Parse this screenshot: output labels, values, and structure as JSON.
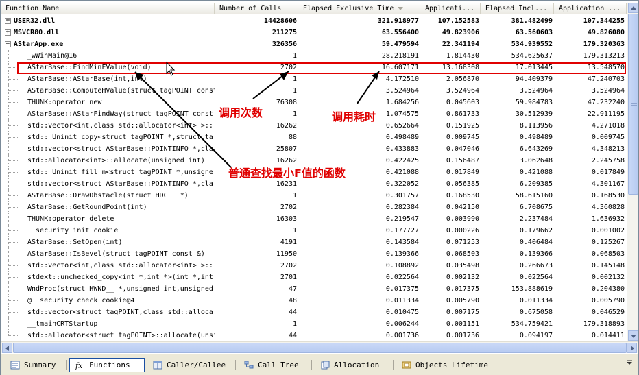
{
  "columns": [
    "Function Name",
    "Number of Calls",
    "Elapsed Exclusive Time",
    "Applicati...",
    "Elapsed Incl...",
    "Application ..."
  ],
  "rows": [
    {
      "name": "USER32.dll",
      "expander": "+",
      "bold": true,
      "level": 0,
      "v": [
        "14428606",
        "321.918977",
        "107.152583",
        "381.482499",
        "107.344255"
      ]
    },
    {
      "name": "MSVCR80.dll",
      "expander": "+",
      "bold": true,
      "level": 0,
      "v": [
        "211275",
        "63.556400",
        "49.823906",
        "63.560603",
        "49.826080"
      ]
    },
    {
      "name": "AStarApp.exe",
      "expander": "−",
      "bold": true,
      "level": 0,
      "v": [
        "326356",
        "59.479594",
        "22.341194",
        "534.939552",
        "179.320363"
      ]
    },
    {
      "name": "_wWinMain@16",
      "level": 1,
      "v": [
        "1",
        "28.218191",
        "1.814430",
        "534.625637",
        "179.313213"
      ]
    },
    {
      "name": "AStarBase::FindMinFValue(void)",
      "level": 1,
      "v": [
        "2702",
        "16.607171",
        "13.168308",
        "17.013445",
        "13.548570"
      ]
    },
    {
      "name": "AStarBase::AStarBase(int,int)",
      "level": 1,
      "v": [
        "1",
        "4.172510",
        "2.056870",
        "94.409379",
        "47.240703"
      ]
    },
    {
      "name": "AStarBase::ComputeHValue(struct tagPOINT const",
      "level": 1,
      "v": [
        "1",
        "3.524964",
        "3.524964",
        "3.524964",
        "3.524964"
      ]
    },
    {
      "name": "THUNK:operator new",
      "level": 1,
      "v": [
        "76308",
        "1.684256",
        "0.045603",
        "59.984783",
        "47.232240"
      ]
    },
    {
      "name": "AStarBase::AStarFindWay(struct tagPOINT const",
      "level": 1,
      "v": [
        "1",
        "1.074575",
        "0.861733",
        "30.512939",
        "22.911195"
      ]
    },
    {
      "name": "std::vector<int,class std::allocator<int> >::",
      "level": 1,
      "v": [
        "16262",
        "0.652664",
        "0.151925",
        "8.113956",
        "4.271018"
      ]
    },
    {
      "name": "std::_Uninit_copy<struct tagPOINT *,struct ta",
      "level": 1,
      "v": [
        "88",
        "0.498489",
        "0.009745",
        "0.498489",
        "0.009745"
      ]
    },
    {
      "name": "std::vector<struct AStarBase::POINTINFO *,cla",
      "level": 1,
      "v": [
        "25807",
        "0.433883",
        "0.047046",
        "6.643269",
        "4.348213"
      ]
    },
    {
      "name": "std::allocator<int>::allocate(unsigned int)",
      "level": 1,
      "v": [
        "16262",
        "0.422425",
        "0.156487",
        "3.062648",
        "2.245758"
      ]
    },
    {
      "name": "std::_Uninit_fill_n<struct tagPOINT *,unsigne",
      "level": 1,
      "v": [
        "",
        "0.421088",
        "0.017849",
        "0.421088",
        "0.017849"
      ]
    },
    {
      "name": "std::vector<struct AStarBase::POINTINFO *,cla",
      "level": 1,
      "v": [
        "16231",
        "0.322052",
        "0.056385",
        "6.209385",
        "4.301167"
      ]
    },
    {
      "name": "AStarBase::DrawObstacle(struct HDC__ *)",
      "level": 1,
      "v": [
        "1",
        "0.301757",
        "0.168530",
        "58.615160",
        "0.168530"
      ]
    },
    {
      "name": "AStarBase::GetRoundPoint(int)",
      "level": 1,
      "v": [
        "2702",
        "0.282384",
        "0.042150",
        "6.708675",
        "4.360828"
      ]
    },
    {
      "name": "THUNK:operator delete",
      "level": 1,
      "v": [
        "16303",
        "0.219547",
        "0.003990",
        "2.237484",
        "1.636932"
      ]
    },
    {
      "name": "__security_init_cookie",
      "level": 1,
      "v": [
        "1",
        "0.177727",
        "0.000226",
        "0.179662",
        "0.001002"
      ]
    },
    {
      "name": "AStarBase::SetOpen(int)",
      "level": 1,
      "v": [
        "4191",
        "0.143584",
        "0.071253",
        "0.406484",
        "0.125267"
      ]
    },
    {
      "name": "AStarBase::IsBevel(struct tagPOINT const &)",
      "level": 1,
      "v": [
        "11950",
        "0.139366",
        "0.068503",
        "0.139366",
        "0.068503"
      ]
    },
    {
      "name": "std::vector<int,class std::allocator<int> >::",
      "level": 1,
      "v": [
        "2702",
        "0.108892",
        "0.035498",
        "0.266673",
        "0.145148"
      ]
    },
    {
      "name": "stdext::unchecked_copy<int *,int *>(int *,int",
      "level": 1,
      "v": [
        "2701",
        "0.022564",
        "0.002132",
        "0.022564",
        "0.002132"
      ]
    },
    {
      "name": "WndProc(struct HWND__ *,unsigned int,unsigned",
      "level": 1,
      "v": [
        "47",
        "0.017375",
        "0.017375",
        "153.888619",
        "0.204380"
      ]
    },
    {
      "name": "@__security_check_cookie@4",
      "level": 1,
      "v": [
        "48",
        "0.011334",
        "0.005790",
        "0.011334",
        "0.005790"
      ]
    },
    {
      "name": "std::vector<struct tagPOINT,class std::alloca",
      "level": 1,
      "v": [
        "44",
        "0.010475",
        "0.007175",
        "0.675058",
        "0.046529"
      ]
    },
    {
      "name": "__tmainCRTStartup",
      "level": 1,
      "v": [
        "1",
        "0.006244",
        "0.001151",
        "534.759421",
        "179.318893"
      ]
    },
    {
      "name": "std::allocator<struct tagPOINT>::allocate(unsi",
      "level": 1,
      "v": [
        "44",
        "0.001736",
        "0.001736",
        "0.094197",
        "0.014411"
      ]
    }
  ],
  "tabs": [
    {
      "label": "Summary",
      "active": false,
      "icon": "summary-icon"
    },
    {
      "label": "Functions",
      "active": true,
      "icon": "functions-icon"
    },
    {
      "label": "Caller/Callee",
      "active": false,
      "icon": "caller-callee-icon"
    },
    {
      "label": "Call Tree",
      "active": false,
      "icon": "call-tree-icon"
    },
    {
      "label": "Allocation",
      "active": false,
      "icon": "allocation-icon"
    },
    {
      "label": "Objects Lifetime",
      "active": false,
      "icon": "objects-lifetime-icon"
    }
  ],
  "annotations": {
    "calls": "调用次数",
    "time": "调用耗时",
    "function": "普通查找最小F值的函数"
  },
  "colors": {
    "annotation": "#e00000",
    "active_tab_border": "#1b4fa2"
  }
}
